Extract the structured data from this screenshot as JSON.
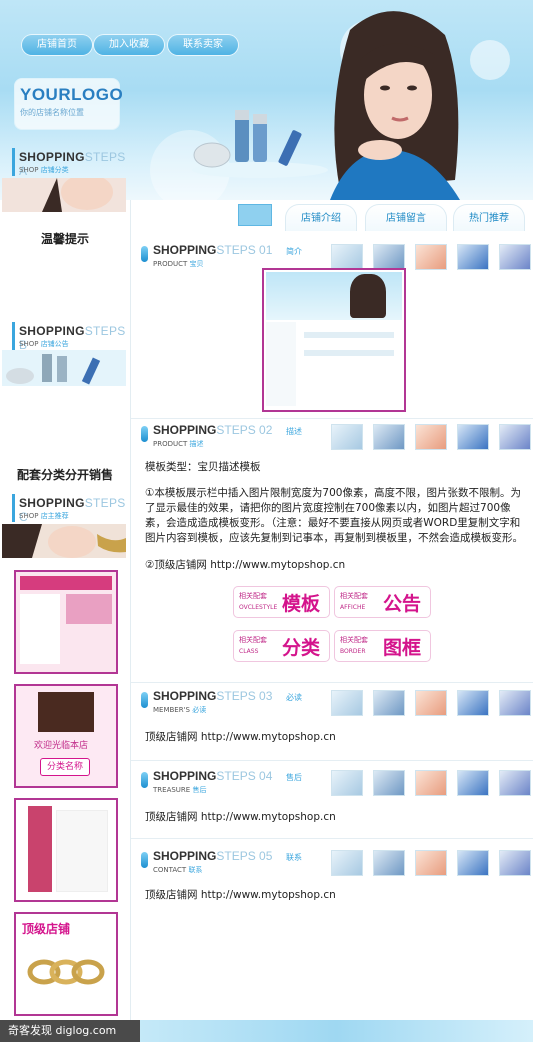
{
  "nav": {
    "items": [
      "店铺首页",
      "加入收藏",
      "联系卖家"
    ]
  },
  "logo": {
    "title": "YOURLOGO",
    "subtitle": "你的店铺名称位置"
  },
  "top_tabs": [
    "店铺介绍",
    "店铺留言",
    "热门推荐"
  ],
  "sidebar": {
    "step_a": {
      "title_a": "SHOPPING",
      "title_b": "STEPS A",
      "sub_a": "SHOP",
      "sub_b": "店铺分类"
    },
    "tip_title": "温馨提示",
    "step_b": {
      "title_a": "SHOPPING",
      "title_b": "STEPS B",
      "sub_a": "SHOP",
      "sub_b": "店铺公告"
    },
    "sell_title": "配套分类分开销售",
    "step_c": {
      "title_a": "SHOPPING",
      "title_b": "STEPS C",
      "sub_a": "SHOP",
      "sub_b": "店主推荐"
    },
    "thumb2_text1": "欢迎光临本店",
    "thumb2_text2": "分类名称",
    "thumb4_text": "顶级店铺"
  },
  "sections": [
    {
      "title_a": "SHOPPING",
      "title_b": "STEPS 01",
      "sub_a": "PRODUCT",
      "sub_b": "宝贝",
      "tag": "简介"
    },
    {
      "title_a": "SHOPPING",
      "title_b": "STEPS 02",
      "sub_a": "PRODUCT",
      "sub_b": "描述",
      "tag": "描述"
    },
    {
      "title_a": "SHOPPING",
      "title_b": "STEPS 03",
      "sub_a": "MEMBER'S",
      "sub_b": "必读",
      "tag": "必读"
    },
    {
      "title_a": "SHOPPING",
      "title_b": "STEPS 04",
      "sub_a": "TREASURE",
      "sub_b": "售后",
      "tag": "售后"
    },
    {
      "title_a": "SHOPPING",
      "title_b": "STEPS 05",
      "sub_a": "CONTACT",
      "sub_b": "联系",
      "tag": "联系"
    }
  ],
  "desc": {
    "type_line": "模板类型：宝贝描述模板",
    "para": "①本模板展示栏中插入图片限制宽度为700像素，高度不限，图片张数不限制。为了显示最佳的效果，请把你的图片宽度控制在700像素以内，如图片超过700像素，会造成造成模板变形。（注意：最好不要直接从网页或者WORD里复制文字和图片内容到模板，应该先复制到记事本，再复制到模板里，不然会造成模板变形。",
    "site_line": "②顶级店铺网  http://www.mytopshop.cn"
  },
  "category_buttons": [
    {
      "l1": "相关配套",
      "l2": "OVCLESTYLE",
      "big": "模板"
    },
    {
      "l1": "相关配套",
      "l2": "AFFICHE",
      "big": "公告"
    },
    {
      "l1": "相关配套",
      "l2": "CLASS",
      "big": "分类"
    },
    {
      "l1": "相关配套",
      "l2": "BORDER",
      "big": "图框"
    }
  ],
  "site_line_short": "顶级店铺网  http://www.mytopshop.cn",
  "watermark": "奇客发现 diglog.com",
  "colors": {
    "accent_blue": "#3ba6de",
    "magenta": "#d4148c",
    "border_magenta": "#b23694"
  }
}
